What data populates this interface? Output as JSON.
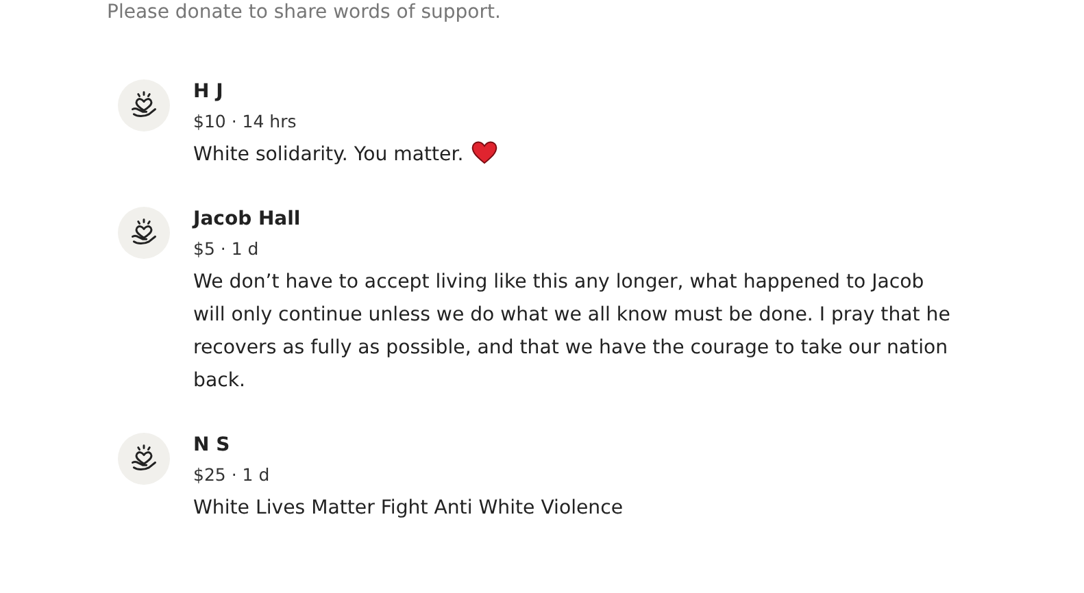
{
  "intro": "Please donate to share words of support.",
  "donations": [
    {
      "name": "H J",
      "amount": "$10",
      "time": "14 hrs",
      "message": "White solidarity. You matter.",
      "heart": true
    },
    {
      "name": "Jacob Hall",
      "amount": "$5",
      "time": "1 d",
      "message": "We don’t have to accept living like this any longer, what happened to Jacob will only continue unless we do what we all know must be done. I pray that he recovers as fully as possible, and that we have the courage to take our nation back.",
      "heart": false
    },
    {
      "name": "N S",
      "amount": "$25",
      "time": "1 d",
      "message": "White Lives Matter Fight Anti White Violence",
      "heart": false
    }
  ],
  "separator": "·"
}
